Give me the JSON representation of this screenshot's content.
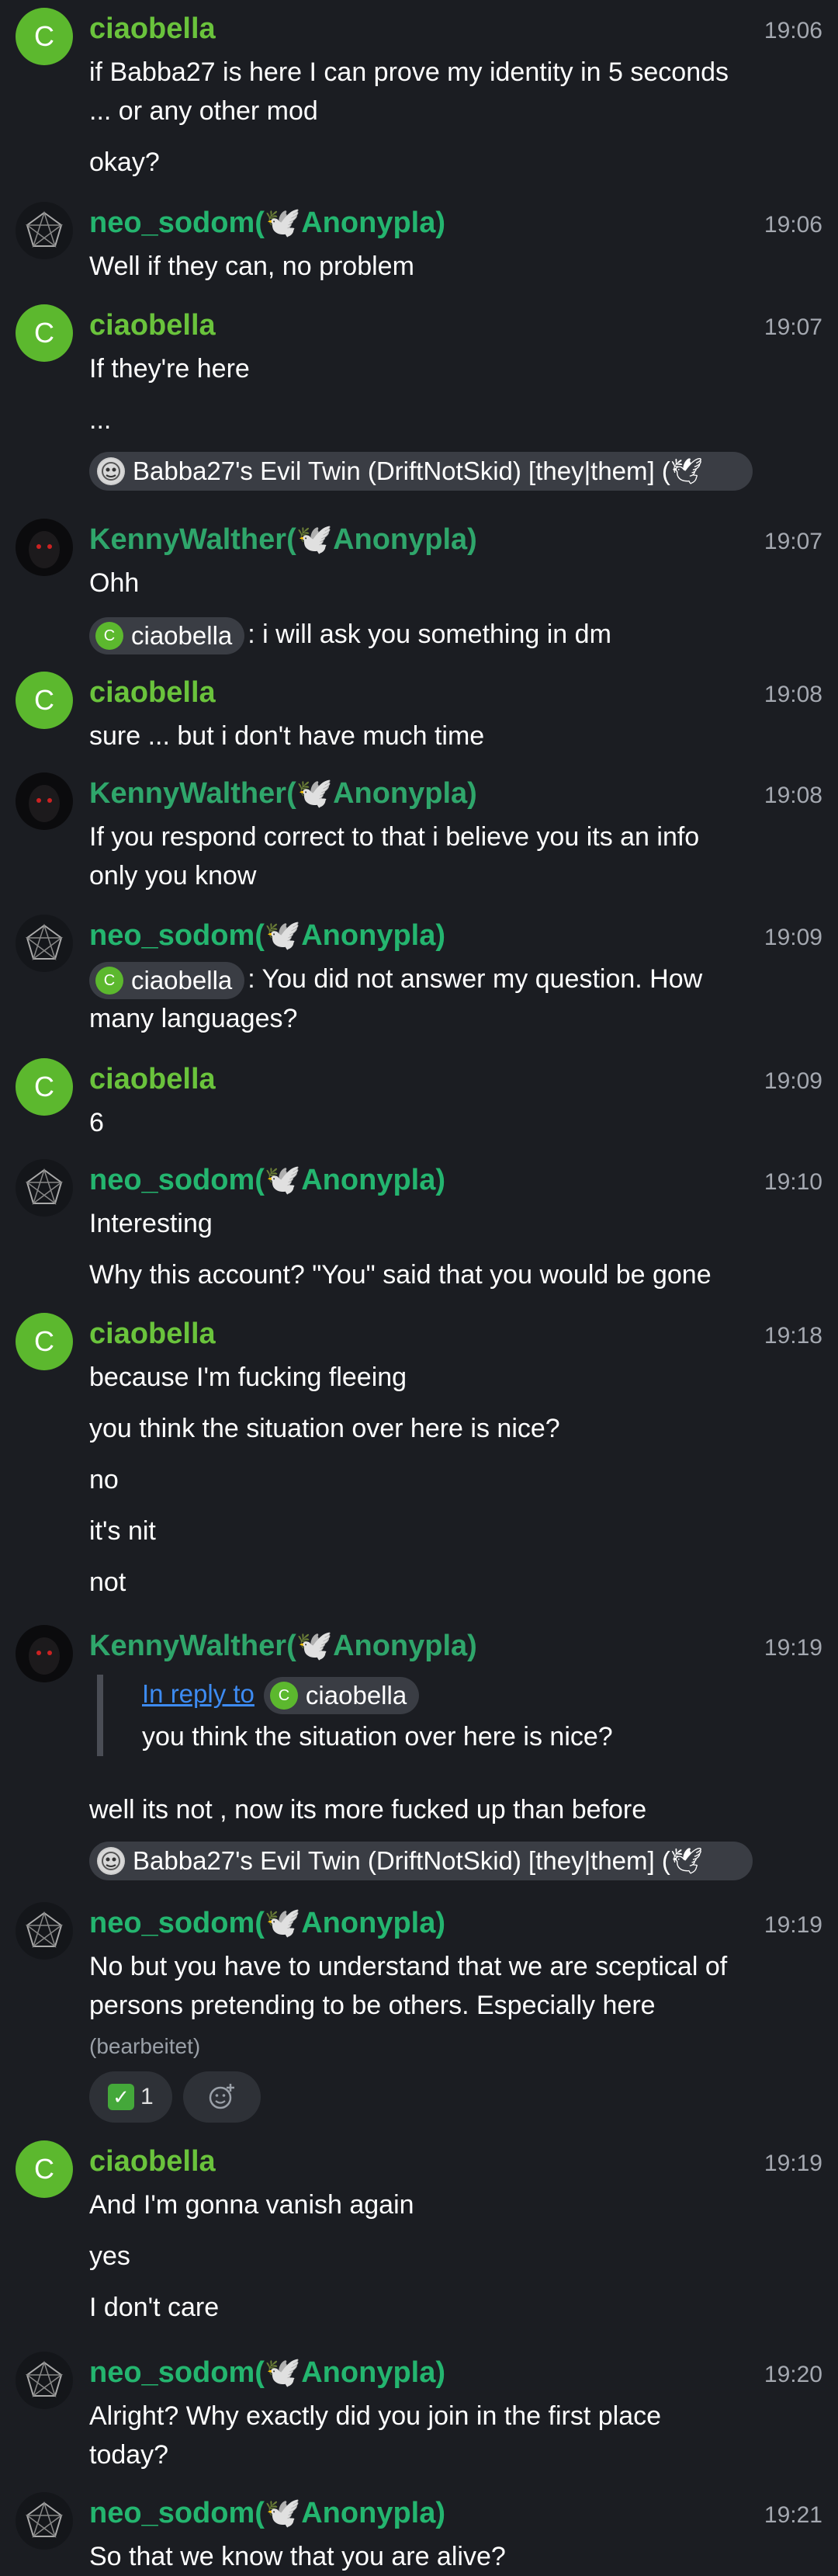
{
  "colors": {
    "ciaobella": "#6ac33c",
    "neo_sodom": "#24b56f",
    "kenny": "#2fa66b",
    "link": "#3d8bf2",
    "background": "#1b1d22"
  },
  "users": {
    "ciaobella": {
      "name": "ciaobella",
      "avatar_letter": "C",
      "pill_letter": "C"
    },
    "neo_sodom": {
      "name": "neo_sodom(",
      "dove": "🕊️",
      "suffix": "Anonypla)"
    },
    "kenny": {
      "name": "KennyWalther(",
      "dove": "🕊️",
      "suffix": "Anonypla)"
    },
    "babba": {
      "pill_text": "Babba27's Evil Twin (DriftNotSkid) [they|them] (🕊"
    }
  },
  "messages": [
    {
      "time": "19:06",
      "lines": [
        "if Babba27 is here I can prove my identity in 5 seconds ... or any other mod",
        "okay?"
      ]
    },
    {
      "time": "19:06",
      "lines": [
        "Well if they can, no problem"
      ]
    },
    {
      "time": "19:07",
      "lines": [
        "If they're here",
        "..."
      ]
    },
    {
      "time": "19:07",
      "lines": [
        "Ohh",
        ": i will ask you something in dm"
      ]
    },
    {
      "time": "19:08",
      "lines": [
        "sure ... but i don't have much time"
      ]
    },
    {
      "time": "19:08",
      "lines": [
        "If you respond correct to that i believe you its an info only you know"
      ]
    },
    {
      "time": "19:09",
      "lines": [
        ": You did not answer my question. How many languages?"
      ]
    },
    {
      "time": "19:09",
      "lines": [
        "6"
      ]
    },
    {
      "time": "19:10",
      "lines": [
        "Interesting",
        "Why this account? \"You\" said that you would be gone"
      ]
    },
    {
      "time": "19:18",
      "lines": [
        "because I'm fucking fleeing",
        "you think the situation over here is nice?",
        "no",
        "it's nit",
        "not"
      ]
    },
    {
      "time": "19:19",
      "reply_label": "In reply to",
      "quote": "you think the situation over here is nice?",
      "lines": [
        "well its not , now its more fucked up than before"
      ]
    },
    {
      "time": "19:19",
      "lines": [
        "No but you have to understand that we are sceptical of persons pretending to be others. Especially here"
      ],
      "edited": "(bearbeitet)",
      "reaction_emoji": "✓",
      "reaction_count": "1",
      "add_reaction_icon": "smiley-add-icon"
    },
    {
      "time": "19:19",
      "lines": [
        "And I'm gonna vanish again",
        "yes",
        "I don't care"
      ]
    },
    {
      "time": "19:20",
      "lines": [
        "Alright? Why exactly did you join in the first place today?"
      ]
    },
    {
      "time": "19:21",
      "lines": [
        "So that we know that you are alive?"
      ]
    }
  ]
}
